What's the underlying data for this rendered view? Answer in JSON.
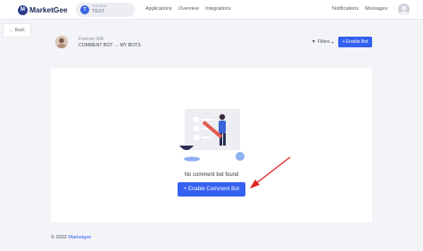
{
  "brand": {
    "name": "MarketGee",
    "logo_letter": "M"
  },
  "workspace": {
    "initial": "T",
    "label": "Preview",
    "name": "TEST"
  },
  "nav": {
    "applications": "Applications",
    "overview": "Overview",
    "integrations": "Integrations",
    "notifications": "Notifications",
    "messages": "Messages"
  },
  "back": {
    "label": "← Back"
  },
  "header": {
    "profile_name": "Frances Gilli",
    "breadcrumb_section": "COMMENT BOT",
    "breadcrumb_separator": "→",
    "breadcrumb_page": "MY BOTS",
    "filters_label": "Filters",
    "enable_bot_label": "+ Enable Bot"
  },
  "empty_state": {
    "message": "No comment bot found",
    "button_label": "+ Enable Comment Bot"
  },
  "footer": {
    "copyright": "© 2022",
    "link": "Marketgee"
  },
  "colors": {
    "primary": "#3561f0",
    "brand_dark": "#1d2b55",
    "annotation_arrow": "#e02424"
  }
}
